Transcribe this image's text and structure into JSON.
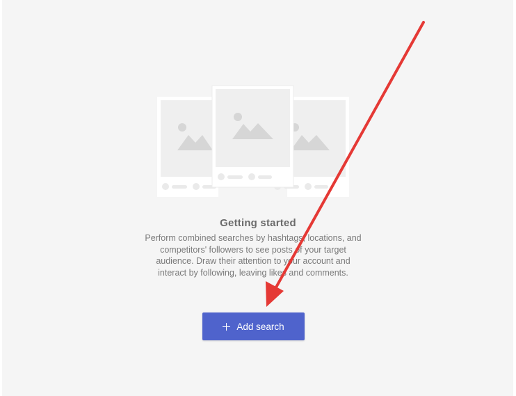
{
  "empty_state": {
    "title": "Getting started",
    "description": "Perform combined searches by hashtags, locations, and competitors' followers to see posts of your target audience. Draw their attention to your account and interact by following, leaving likes and comments.",
    "add_button_label": "Add search",
    "add_button_icon": "plus-icon",
    "illustration_icon": "image-placeholder-icon"
  },
  "colors": {
    "background": "#f5f5f5",
    "button": "#4f63cc",
    "annotation_arrow": "#e53935"
  }
}
